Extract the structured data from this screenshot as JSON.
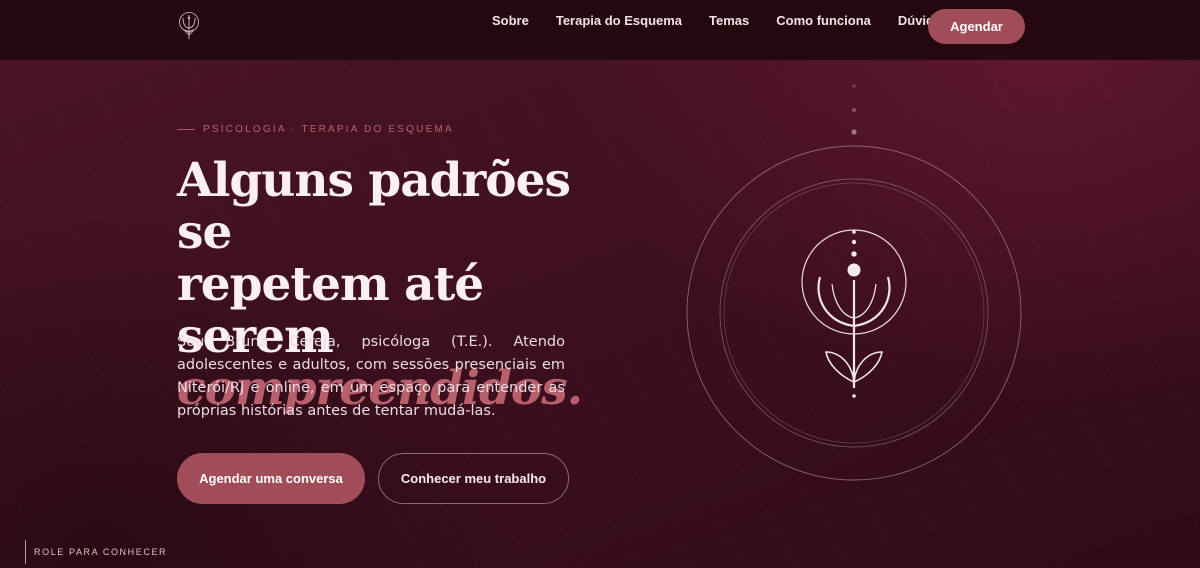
{
  "nav": {
    "items": [
      "Sobre",
      "Terapia do Esquema",
      "Temas",
      "Como funciona",
      "Dúvidas"
    ],
    "cta": "Agendar"
  },
  "hero": {
    "eyebrow": "PSICOLOGIA · TERAPIA DO ESQUEMA",
    "headline_line1": "Alguns padrões se",
    "headline_line2": "repetem até serem",
    "headline_accent": "compreendidos.",
    "intro": "Sou Bruna Cereja, psicóloga (T.E.). Atendo adolescentes e adultos, com sessões presenciais em Niterói/RJ e online, em um espaço para entender as próprias histórias antes de tentar mudá-las.",
    "primary_button": "Agendar uma conversa",
    "secondary_button": "Conhecer meu trabalho"
  },
  "scroll_hint": "ROLE PARA CONHECER",
  "colors": {
    "accent": "#a14d59",
    "accent_text": "#b85f6c",
    "header_bg": "#25080f",
    "background": "#3e1020"
  },
  "icons": {
    "logo": "psi-lotus-icon",
    "emblem": "psi-lotus-emblem"
  }
}
